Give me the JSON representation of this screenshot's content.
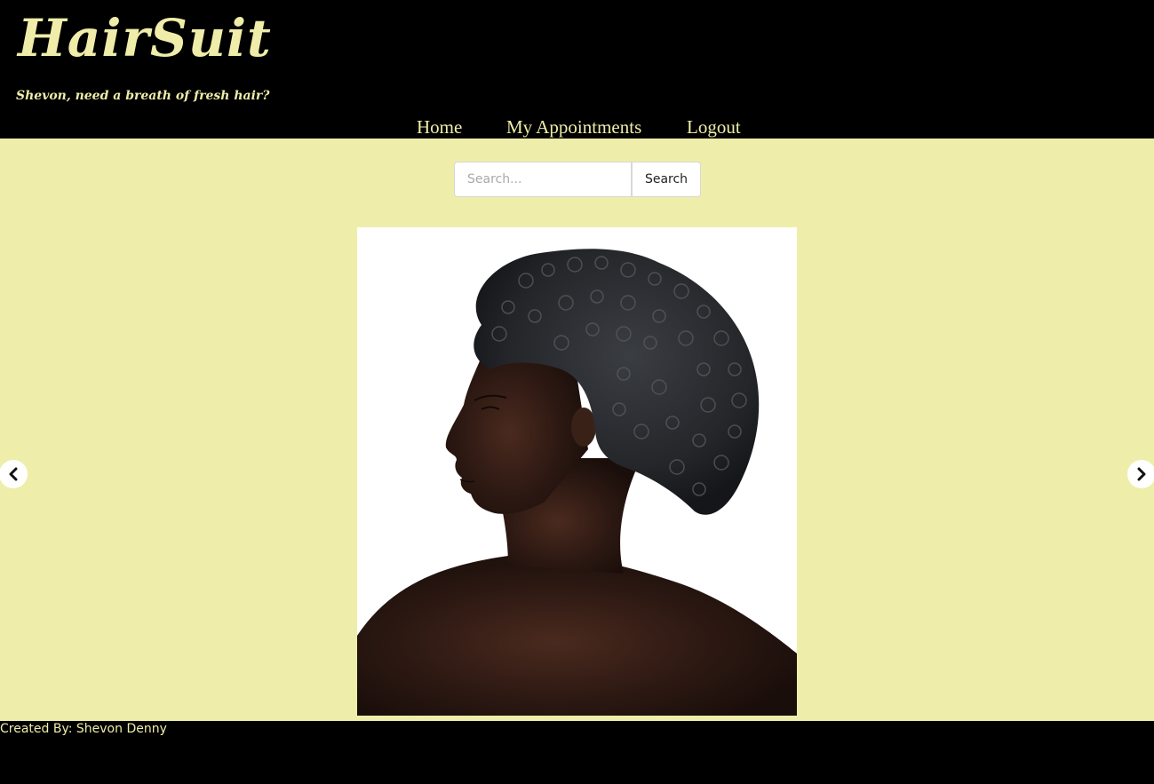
{
  "brand": {
    "logo_text": "HairSuit",
    "tagline": "Shevon, need a breath of fresh hair?"
  },
  "nav": {
    "home": "Home",
    "appointments": "My Appointments",
    "logout": "Logout"
  },
  "search": {
    "placeholder": "Search...",
    "value": "",
    "button_label": "Search"
  },
  "carousel": {
    "image_alt": "Side profile of a woman with short curly hair",
    "prev_icon": "chevron-left-icon",
    "next_icon": "chevron-right-icon"
  },
  "footer": {
    "credit": "Created By: Shevon Denny"
  },
  "colors": {
    "accent": "#efeda9",
    "main_bg": "#eeeeaa",
    "header_bg": "#000000"
  }
}
